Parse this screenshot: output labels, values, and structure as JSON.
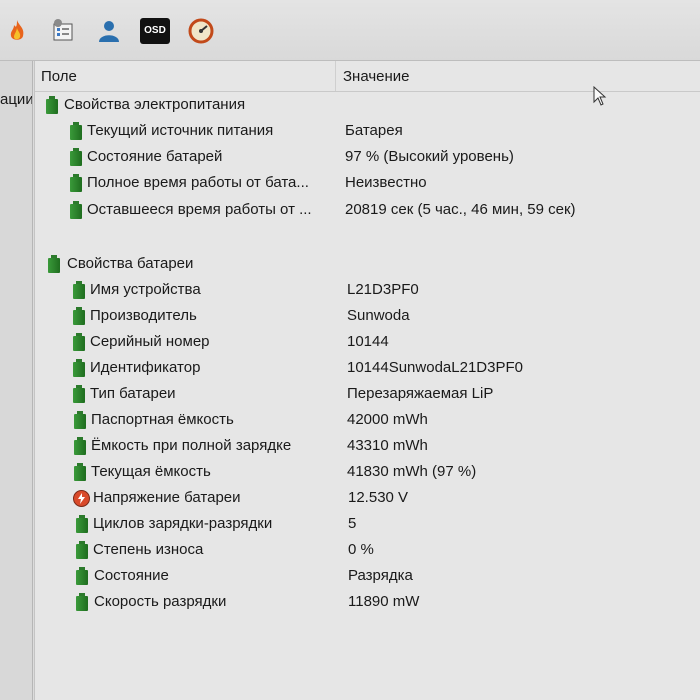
{
  "toolbar": {
    "icons": [
      "fire-icon",
      "system-icon",
      "user-icon",
      "osd-icon",
      "gauge-icon"
    ],
    "osd_label": "OSD"
  },
  "left_pane": {
    "cut_label": "ации"
  },
  "table": {
    "col_field": "Поле",
    "col_value": "Значение"
  },
  "power": {
    "title": "Свойства электропитания",
    "rows": [
      {
        "label": "Текущий источник питания",
        "value": "Батарея"
      },
      {
        "label": "Состояние батарей",
        "value": "97 % (Высокий уровень)"
      },
      {
        "label": "Полное время работы от бата...",
        "value": "Неизвестно"
      },
      {
        "label": "Оставшееся время работы от ...",
        "value": "20819 сек (5 час., 46 мин, 59 сек)"
      }
    ]
  },
  "battery": {
    "title": "Свойства батареи",
    "rows": [
      {
        "label": "Имя устройства",
        "value": "L21D3PF0"
      },
      {
        "label": "Производитель",
        "value": "Sunwoda"
      },
      {
        "label": "Серийный номер",
        "value": "10144"
      },
      {
        "label": "Идентификатор",
        "value": "10144SunwodaL21D3PF0"
      },
      {
        "label": "Тип батареи",
        "value": "Перезаряжаемая LiP"
      },
      {
        "label": "Паспортная ёмкость",
        "value": "42000 mWh"
      },
      {
        "label": "Ёмкость при полной зарядке",
        "value": "43310 mWh"
      },
      {
        "label": "Текущая ёмкость",
        "value": "41830 mWh  (97 %)"
      },
      {
        "label": "Напряжение батареи",
        "value": "12.530 V"
      },
      {
        "label": "Циклов зарядки-разрядки",
        "value": "5"
      },
      {
        "label": "Степень износа",
        "value": "0 %"
      },
      {
        "label": "Состояние",
        "value": "Разрядка"
      },
      {
        "label": "Скорость разрядки",
        "value": "11890 mW"
      }
    ]
  },
  "colors": {
    "battery_green": "#2e8b2e",
    "bolt_red": "#d94a2a"
  }
}
